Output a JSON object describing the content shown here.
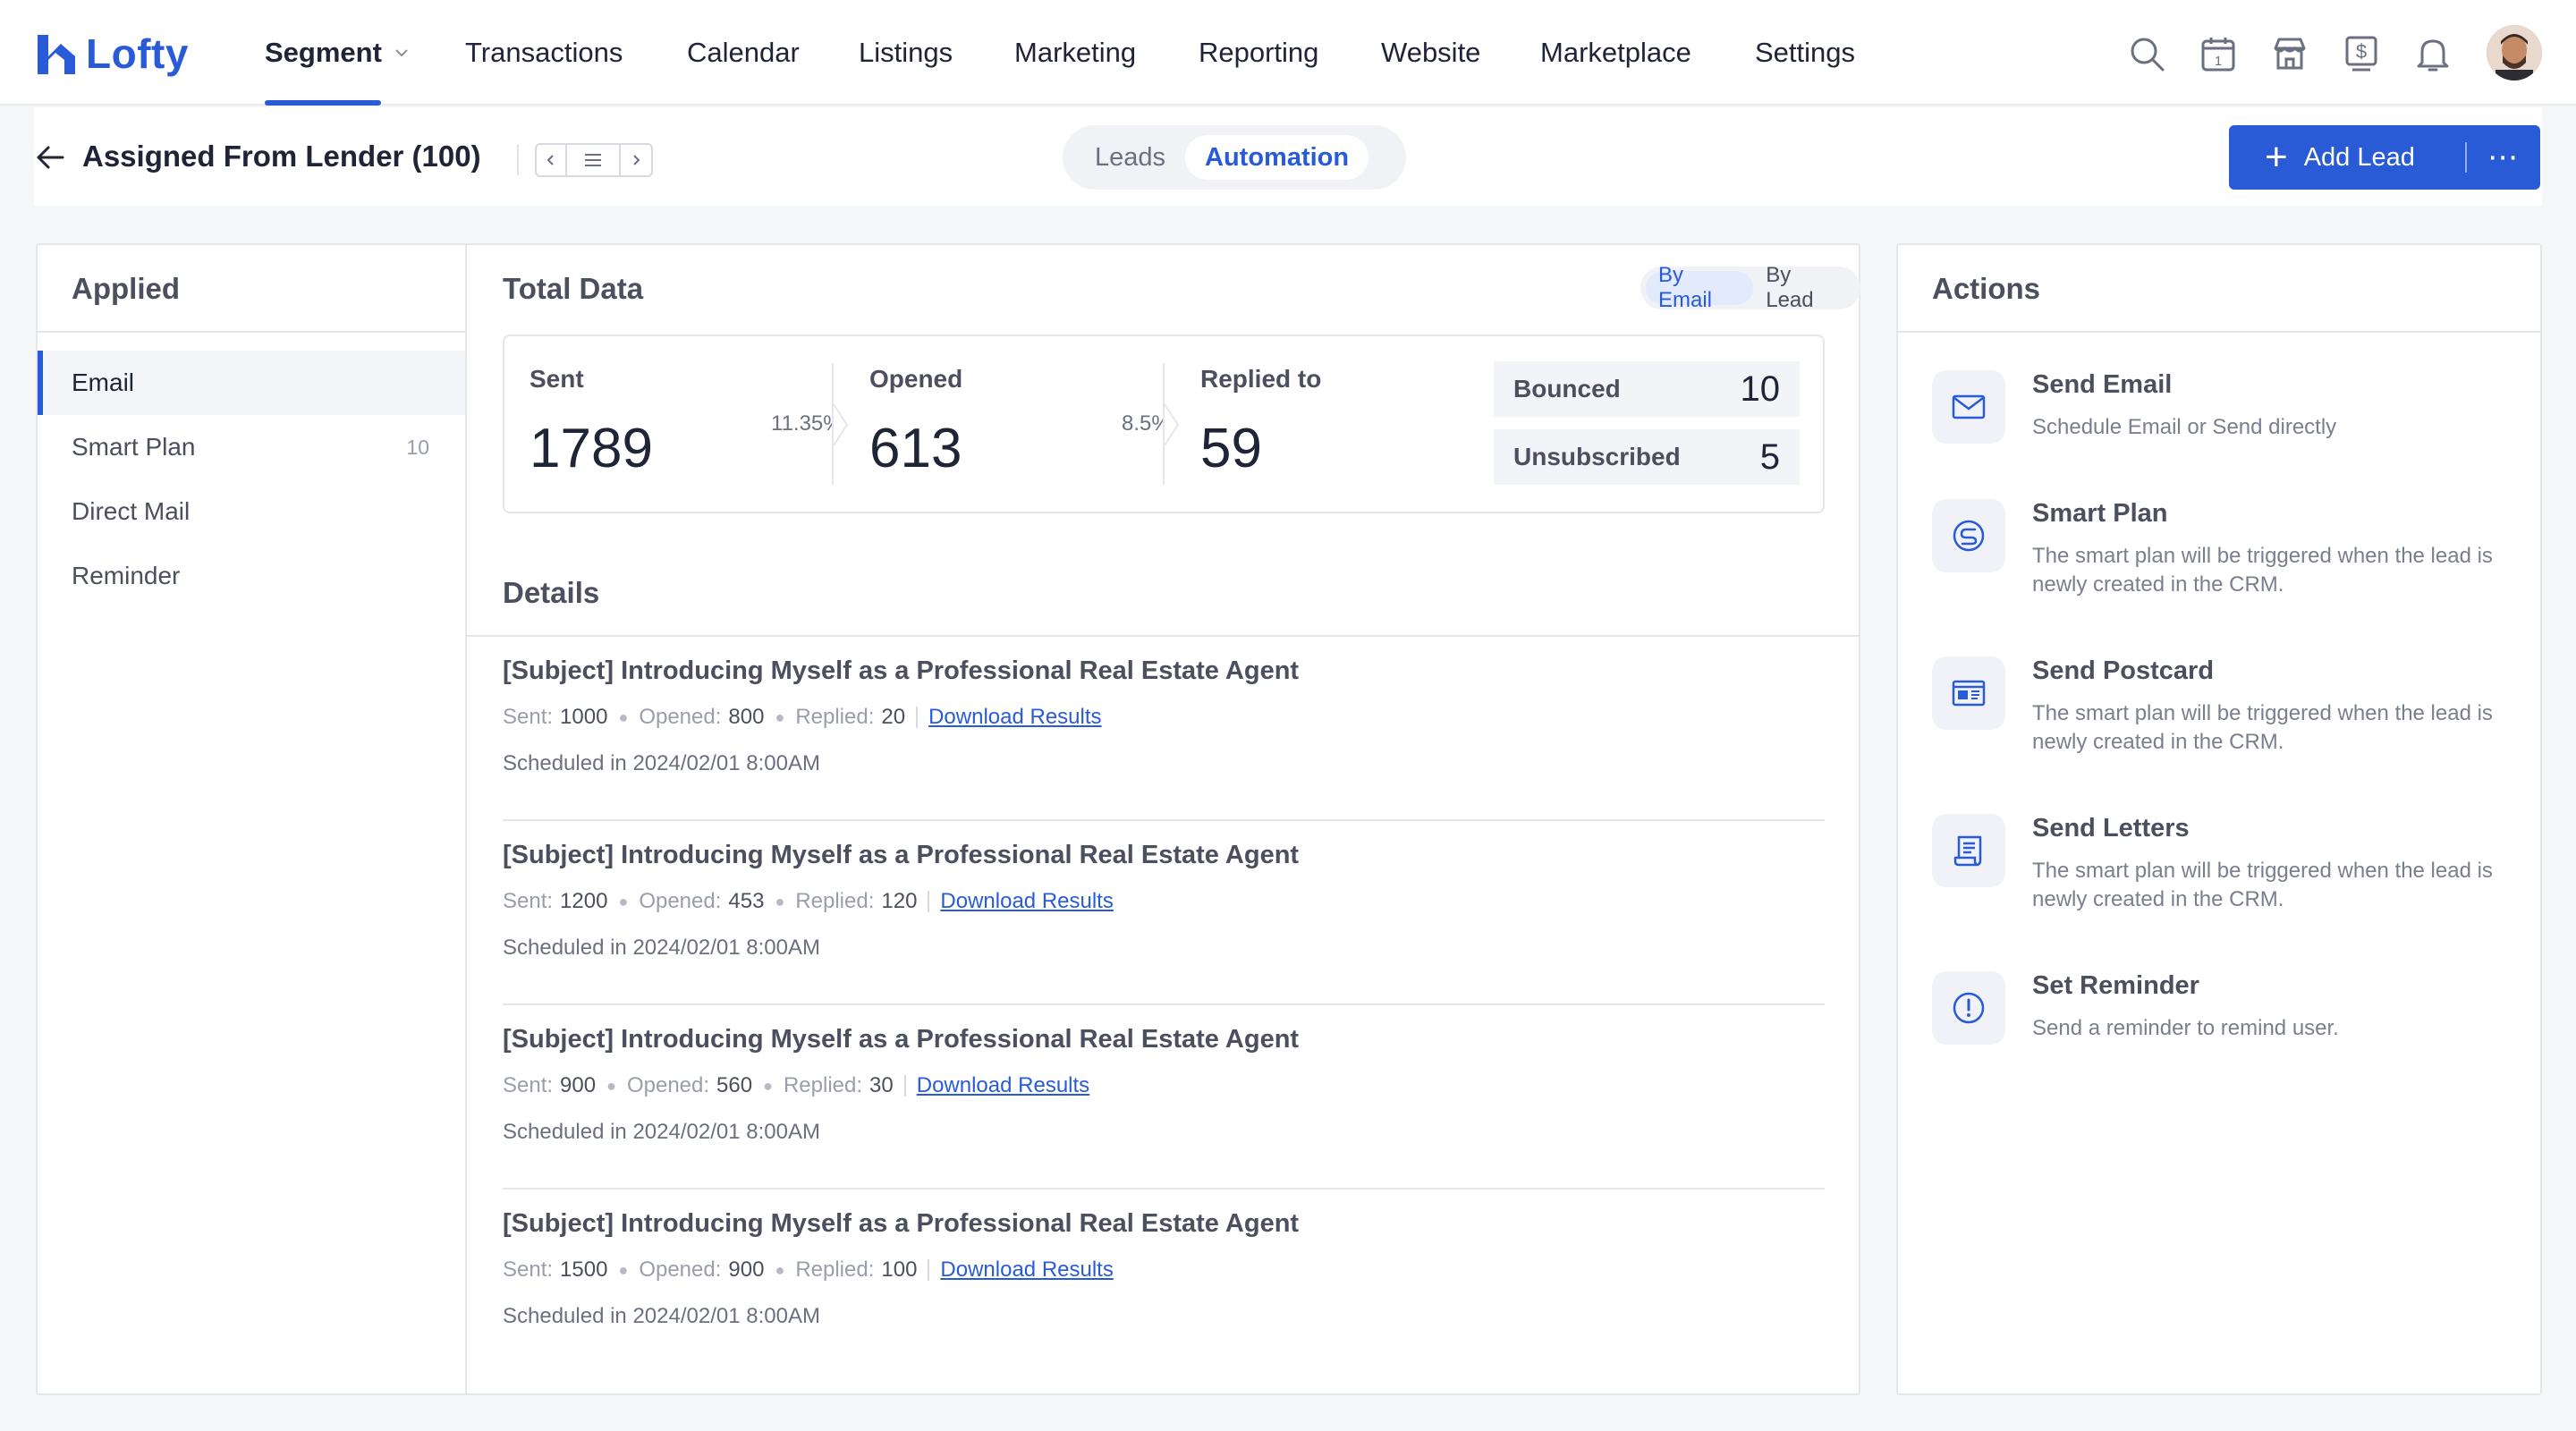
{
  "brand": {
    "name": "Lofty",
    "accent": "#2a5bd7"
  },
  "nav": {
    "items": [
      {
        "label": "Segment",
        "active": true
      },
      {
        "label": "Transactions"
      },
      {
        "label": "Calendar"
      },
      {
        "label": "Listings"
      },
      {
        "label": "Marketing"
      },
      {
        "label": "Reporting"
      },
      {
        "label": "Website"
      },
      {
        "label": "Marketplace"
      },
      {
        "label": "Settings"
      }
    ],
    "icons": [
      "search-icon",
      "calendar-icon",
      "store-icon",
      "dollar-icon",
      "bell-icon",
      "avatar"
    ],
    "calendar_day": "1"
  },
  "subheader": {
    "title": "Assigned From Lender (100)",
    "tabs": [
      {
        "label": "Leads"
      },
      {
        "label": "Automation",
        "active": true
      }
    ],
    "add_lead_label": "Add Lead",
    "more_label": "⋯"
  },
  "applied": {
    "title": "Applied",
    "items": [
      {
        "label": "Email",
        "count": "",
        "active": true
      },
      {
        "label": "Smart Plan",
        "count": "10"
      },
      {
        "label": "Direct Mail",
        "count": ""
      },
      {
        "label": "Reminder",
        "count": ""
      }
    ]
  },
  "total": {
    "title": "Total Data",
    "toggle": [
      {
        "label": "By Email",
        "active": true
      },
      {
        "label": "By Lead"
      }
    ],
    "sent_label": "Sent",
    "sent_value": "1789",
    "opened_pct": "11.35%",
    "opened_label": "Opened",
    "opened_value": "613",
    "replied_pct": "8.5%",
    "replied_label": "Replied to",
    "replied_value": "59",
    "bounced_label": "Bounced",
    "bounced_value": "10",
    "unsub_label": "Unsubscribed",
    "unsub_value": "5"
  },
  "details": {
    "title": "Details",
    "rows": [
      {
        "subject": "[Subject] Introducing Myself as a Professional Real Estate Agent",
        "sent_label": "Sent:",
        "sent": "1000",
        "opened_label": "Opened:",
        "opened": "800",
        "replied_label": "Replied:",
        "replied": "20",
        "link": "Download Results",
        "scheduled": "Scheduled in 2024/02/01 8:00AM"
      },
      {
        "subject": "[Subject] Introducing Myself as a Professional Real Estate Agent",
        "sent_label": "Sent:",
        "sent": "1200",
        "opened_label": "Opened:",
        "opened": "453",
        "replied_label": "Replied:",
        "replied": "120",
        "link": "Download Results",
        "scheduled": "Scheduled in 2024/02/01 8:00AM"
      },
      {
        "subject": "[Subject] Introducing Myself as a Professional Real Estate Agent",
        "sent_label": "Sent:",
        "sent": "900",
        "opened_label": "Opened:",
        "opened": "560",
        "replied_label": "Replied:",
        "replied": "30",
        "link": "Download Results",
        "scheduled": "Scheduled in 2024/02/01 8:00AM"
      },
      {
        "subject": "[Subject] Introducing Myself as a Professional Real Estate Agent",
        "sent_label": "Sent:",
        "sent": "1500",
        "opened_label": "Opened:",
        "opened": "900",
        "replied_label": "Replied:",
        "replied": "100",
        "link": "Download Results",
        "scheduled": "Scheduled in 2024/02/01 8:00AM"
      }
    ]
  },
  "actions": {
    "title": "Actions",
    "items": [
      {
        "title": "Send Email",
        "desc": "Schedule Email or Send directly",
        "icon": "envelope-icon"
      },
      {
        "title": "Smart Plan",
        "desc": "The smart plan will be triggered when the lead is newly created in the CRM.",
        "icon": "smart-plan-icon"
      },
      {
        "title": "Send Postcard",
        "desc": "The smart plan will be triggered when the lead is newly created in the CRM.",
        "icon": "postcard-icon"
      },
      {
        "title": "Send Letters",
        "desc": "The smart plan will be triggered when the lead is newly created in the CRM.",
        "icon": "letter-icon"
      },
      {
        "title": "Set Reminder",
        "desc": "Send a reminder to remind user.",
        "icon": "reminder-icon"
      }
    ]
  }
}
